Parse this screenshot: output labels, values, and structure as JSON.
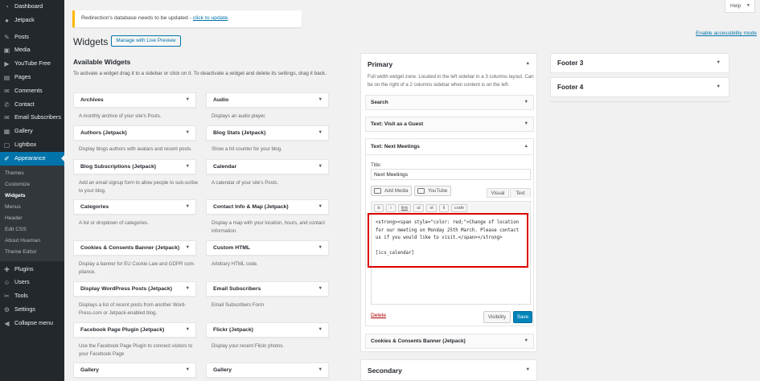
{
  "sidebar": {
    "items": [
      {
        "label": "Dashboard",
        "icon": "dashboard-icon",
        "glyph": "◔"
      },
      {
        "label": "Jetpack",
        "icon": "jetpack-icon",
        "glyph": "●"
      },
      {
        "label": "Posts",
        "icon": "pin-icon",
        "glyph": "✎"
      },
      {
        "label": "Media",
        "icon": "media-icon",
        "glyph": "▣"
      },
      {
        "label": "YouTube Free",
        "icon": "youtube-icon",
        "glyph": "▶"
      },
      {
        "label": "Pages",
        "icon": "pages-icon",
        "glyph": "▤"
      },
      {
        "label": "Comments",
        "icon": "comments-icon",
        "glyph": "✉"
      },
      {
        "label": "Contact",
        "icon": "contact-icon",
        "glyph": "✆"
      },
      {
        "label": "Email Subscribers",
        "icon": "email-icon",
        "glyph": "✉"
      },
      {
        "label": "Gallery",
        "icon": "gallery-icon",
        "glyph": "▦"
      },
      {
        "label": "Lightbox",
        "icon": "lightbox-icon",
        "glyph": "▢"
      },
      {
        "label": "Appearance",
        "icon": "brush-icon",
        "glyph": "✐"
      }
    ],
    "submenu": [
      "Themes",
      "Customize",
      "Widgets",
      "Menus",
      "Header",
      "Edit CSS",
      "About Hueman",
      "Theme Editor"
    ],
    "items_after": [
      {
        "label": "Plugins",
        "icon": "plugins-icon",
        "glyph": "✚"
      },
      {
        "label": "Users",
        "icon": "users-icon",
        "glyph": "☺"
      },
      {
        "label": "Tools",
        "icon": "tools-icon",
        "glyph": "✂"
      },
      {
        "label": "Settings",
        "icon": "settings-icon",
        "glyph": "⚙"
      },
      {
        "label": "Collapse menu",
        "icon": "collapse-icon",
        "glyph": "◀"
      }
    ]
  },
  "help_label": "Help",
  "notice": {
    "text": "Redirection's database needs to be updated - ",
    "link": "click to update",
    "end": "."
  },
  "page_title": "Widgets",
  "live_preview_label": "Manage with Live Preview",
  "accessibility_link": "Enable accessibility mode",
  "available": {
    "heading": "Available Widgets",
    "description": "To activate a widget drag it to a sidebar or click on it. To deactivate a widget and delete its settings, drag it back.",
    "widgets": [
      {
        "title": "Archives",
        "desc": "A monthly archive of your site's Posts."
      },
      {
        "title": "Audio",
        "desc": "Displays an audio player."
      },
      {
        "title": "Authors (Jetpack)",
        "desc": "Display blogs authors with avatars and recent posts."
      },
      {
        "title": "Blog Stats (Jetpack)",
        "desc": "Show a hit counter for your blog."
      },
      {
        "title": "Blog Subscriptions (Jetpack)",
        "desc": "Add an email signup form to allow people to sub-scribe to your blog."
      },
      {
        "title": "Calendar",
        "desc": "A calendar of your site's Posts."
      },
      {
        "title": "Categories",
        "desc": "A list or dropdown of categories."
      },
      {
        "title": "Contact Info & Map (Jetpack)",
        "desc": "Display a map with your location, hours, and contact information."
      },
      {
        "title": "Cookies & Consents Banner (Jetpack)",
        "desc": "Display a banner for EU Cookie Law and GDPR com-pliance."
      },
      {
        "title": "Custom HTML",
        "desc": "Arbitrary HTML code."
      },
      {
        "title": "Display WordPress Posts (Jetpack)",
        "desc": "Displays a list of recent posts from another Word-Press.com or Jetpack-enabled blog."
      },
      {
        "title": "Email Subscribers",
        "desc": "Email Subscribers Form"
      },
      {
        "title": "Facebook Page Plugin (Jetpack)",
        "desc": "Use the Facebook Page Plugin to connect visitors to your Facebook Page"
      },
      {
        "title": "Flickr (Jetpack)",
        "desc": "Display your recent Flickr photos."
      },
      {
        "title": "Gallery",
        "desc": ""
      },
      {
        "title": "Gallery",
        "desc": ""
      }
    ]
  },
  "primary": {
    "title": "Primary",
    "description": "Full width widget zone. Located in the left sidebar in a 3 columns layout. Can be on the right of a 2 columns sidebar when content is on the left.",
    "widgets": [
      "Search",
      "Text: Visit as a Guest",
      "Text: Next Meetings"
    ],
    "editor": {
      "title_label": "Title:",
      "title_value": "Next Meetings",
      "add_media": "Add Media",
      "youtube": "YouTube",
      "tab_visual": "Visual",
      "tab_text": "Text",
      "quicktags": [
        "b",
        "i",
        "link",
        "ul",
        "ol",
        "li",
        "code"
      ],
      "content": "<strong><span style=\"color: red;\">Change of location for our meeting on Monday 25th March. Please contact us if you would like to visit.</span></strong>\n\n[ics_calendar]",
      "delete": "Delete",
      "visibility": "Visibility",
      "save": "Save"
    },
    "after_widget": "Cookies & Consents Banner (Jetpack)"
  },
  "secondary_title": "Secondary",
  "footers": [
    "Footer 3",
    "Footer 4"
  ],
  "colors": {
    "accent": "#0073aa",
    "sidebar_bg": "#23282d",
    "notice_border": "#ffb900",
    "highlight": "#dd0000"
  }
}
